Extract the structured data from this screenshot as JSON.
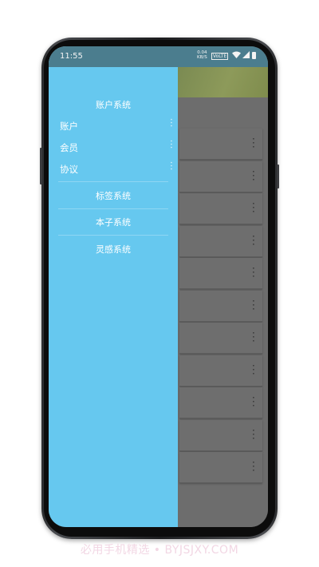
{
  "status_bar": {
    "time": "11:55",
    "speed_value": "0.04",
    "speed_unit": "KB/S",
    "network_badge": "VoLTE",
    "wifi_icon": "wifi-icon",
    "signal_icon": "signal-icon",
    "battery_icon": "battery-icon"
  },
  "drawer": {
    "background_color": "#66c8ef",
    "header": "账户系统",
    "sub_items": [
      {
        "label": "账户",
        "icon": "more-vertical-icon"
      },
      {
        "label": "会员",
        "icon": "more-vertical-icon"
      },
      {
        "label": "协议",
        "icon": "more-vertical-icon"
      }
    ],
    "sections": [
      {
        "label": "标签系统"
      },
      {
        "label": "本子系统"
      },
      {
        "label": "灵感系统"
      }
    ]
  },
  "background_list": {
    "header_color": "#8d9a5a",
    "row_count": 11,
    "row_icon": "more-vertical-icon"
  },
  "watermark": "必用手机精选 • BYJSJXY.COM"
}
